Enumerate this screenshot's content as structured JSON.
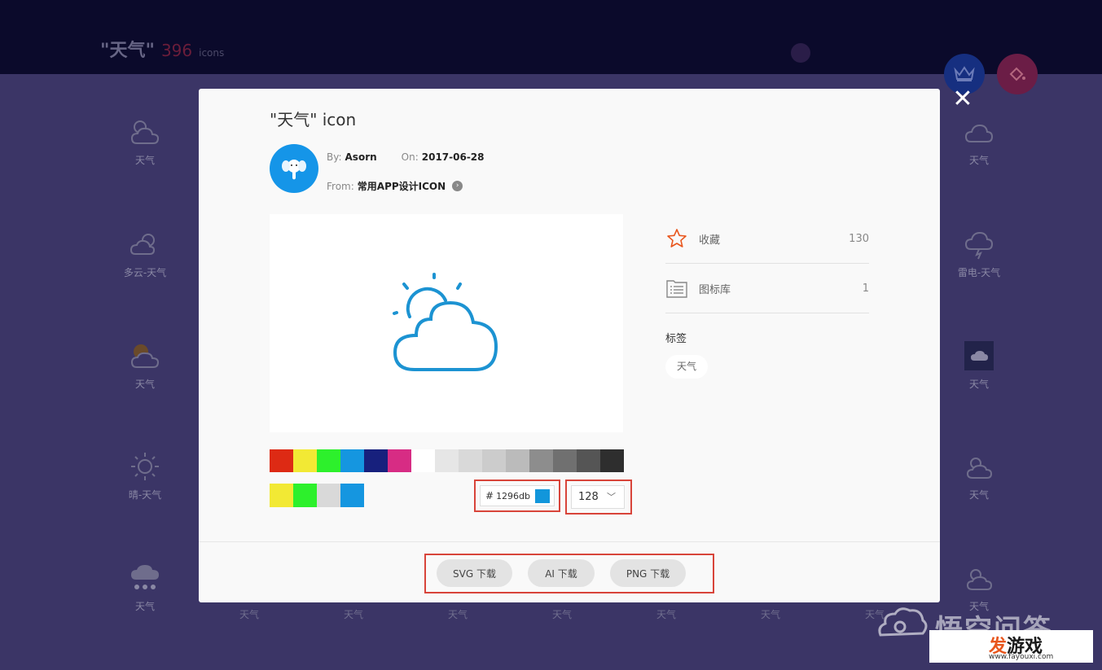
{
  "background": {
    "title_quoted": "\"天气\"",
    "count": "396",
    "count_unit": "icons",
    "grid_labels": {
      "col_left": [
        "天气",
        "多云-天气",
        "天气",
        "晴-天气",
        "天气"
      ],
      "col_right": [
        "天气",
        "雷电-天气",
        "天气",
        "天气",
        "天气"
      ],
      "bottom_row": [
        "天气",
        "天气",
        "天气",
        "天气",
        "天气",
        "天气",
        "天气"
      ]
    }
  },
  "modal": {
    "title": "\"天气\" icon",
    "close_symbol": "✕",
    "by_label": "By:",
    "author": "Asorn",
    "on_label": "On:",
    "date": "2017-06-28",
    "from_label": "From:",
    "source": "常用APP设计ICON",
    "palette_colors": [
      "#dd2a14",
      "#f2e934",
      "#2df02c",
      "#1596e0",
      "#17207d",
      "#d72c84",
      "#ffffff",
      "#e6e6e6",
      "#d9d9d9",
      "#cccccc",
      "#bbbbbb",
      "#8d8d8d",
      "#707070",
      "#555555",
      "#2e2e2e"
    ],
    "recent_colors": [
      "#f2e934",
      "#2df02c",
      "#d9d9d9",
      "#1596e0"
    ],
    "hash": "#",
    "hex_value": "1296db",
    "current_color": "#1296db",
    "size_value": "128",
    "chevron": "﹀",
    "favorite_label": "收藏",
    "favorite_count": "130",
    "library_label": "图标库",
    "library_count": "1",
    "tags_title": "标签",
    "tags": [
      "天气"
    ],
    "downloads": {
      "svg": "SVG 下载",
      "ai": "AI 下载",
      "png": "PNG 下载"
    }
  },
  "watermark": {
    "text": "悟空问答",
    "brand_fa": "发",
    "brand_rest": "游戏",
    "url": "www.fayouxi.com"
  }
}
